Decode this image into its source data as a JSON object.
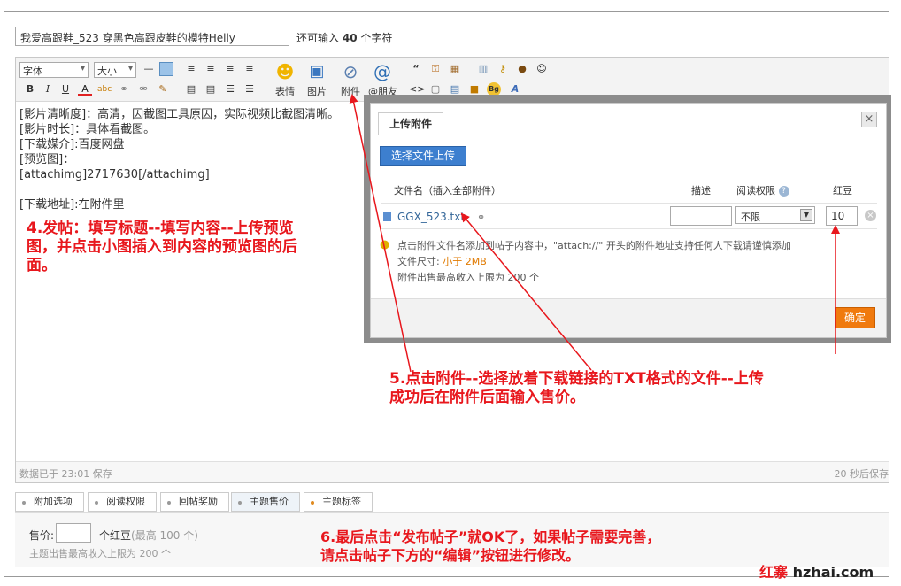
{
  "title": {
    "value": "我爱高跟鞋_523 穿黑色高跟皮鞋的模特Helly",
    "hint_prefix": "还可输入",
    "hint_count": "40",
    "hint_suffix": "个字符"
  },
  "toolbar": {
    "font_select": "字体",
    "size_select": "大小",
    "buttons": {
      "bold": "B",
      "italic": "I",
      "underline": "U",
      "color": "A",
      "emoji_label": "表情",
      "image_label": "图片",
      "attach_label": "附件",
      "mention_label": "@朋友",
      "quote": "“",
      "code": "<>",
      "bg": "Bg"
    }
  },
  "editor": {
    "lines": [
      "[影片清晰度]：高清，因截图工具原因，实际视频比截图清晰。",
      "[影片时长]：具体看截图。",
      "[下载媒介]:百度网盘",
      "[预览图]：",
      "[attachimg]2717630[/attachimg]",
      "",
      "[下载地址]:在附件里"
    ],
    "status_saved": "数据已于 23:01 保存",
    "status_autosave": "20 秒后保存"
  },
  "tabs": [
    {
      "label": "附加选项"
    },
    {
      "label": "阅读权限"
    },
    {
      "label": "回帖奖励"
    },
    {
      "label": "主题售价"
    },
    {
      "label": "主题标签"
    }
  ],
  "price_panel": {
    "label": "售价:",
    "unit": "个红豆",
    "max_hint": "(最高 100 个)",
    "limit": "主题出售最高收入上限为 200 个"
  },
  "dialog": {
    "tab": "上传附件",
    "close": "×",
    "upload_button": "选择文件上传",
    "columns": {
      "filename": "文件名（插入全部附件）",
      "desc": "描述",
      "perm": "阅读权限",
      "price": "红豆"
    },
    "file": {
      "name": "GGX_523.txt",
      "perm": "不限",
      "price": "10"
    },
    "tips": {
      "line1": "点击附件文件名添加到帖子内容中，\"attach://\" 开头的附件地址支持任何人下载请谨慎添加",
      "size_label": "文件尺寸:",
      "size_value": "小于 2MB",
      "line3": "附件出售最高收入上限为 200 个"
    },
    "confirm": "确定"
  },
  "annotations": {
    "step4_line1": "4.发帖：填写标题--填写内容--上传预览",
    "step4_line2": "图，并点击小图插入到内容的预览图的后",
    "step4_line3": "面。",
    "step5_line1": "5.点击附件--选择放着下载链接的TXT格式的文件--上传",
    "step5_line2": "成功后在附件后面输入售价。",
    "step6_line1": "6.最后点击“发布帖子”就OK了，如果帖子需要完善，",
    "step6_line2": "请点击帖子下方的“编辑”按钮进行修改。"
  },
  "watermark": {
    "cn": "红寨",
    "en": "hzhai.com"
  },
  "colors": {
    "annotation": "#e8171d",
    "upload_button": "#3d7fcf",
    "confirm_button": "#f07a0e",
    "link": "#336699"
  }
}
